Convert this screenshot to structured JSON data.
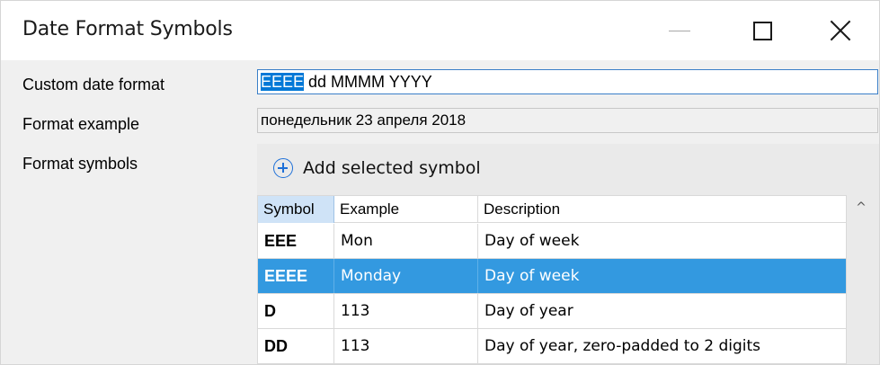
{
  "window": {
    "title": "Date Format Symbols",
    "minimize_icon": "minimize-icon",
    "maximize_icon": "maximize-icon",
    "close_icon": "close-icon"
  },
  "form": {
    "custom_format_label": "Custom date format",
    "custom_format_value_selected": "EEEE",
    "custom_format_value_rest": " dd MMMM YYYY",
    "example_label": "Format example",
    "example_value": "понедельник 23 апреля 2018",
    "symbols_label": "Format symbols"
  },
  "symbols": {
    "add_button_label": "Add selected symbol",
    "add_icon": "plus-circle-icon",
    "columns": [
      "Symbol",
      "Example",
      "Description"
    ],
    "rows": [
      {
        "symbol": "EEE",
        "example": "Mon",
        "description": "Day of week"
      },
      {
        "symbol": "EEEE",
        "example": "Monday",
        "description": "Day of week"
      },
      {
        "symbol": "D",
        "example": "113",
        "description": "Day of year"
      },
      {
        "symbol": "DD",
        "example": "113",
        "description": "Day of year, zero-padded to 2 digits"
      }
    ],
    "selected_row_index": 1,
    "scroll_up_glyph": "^"
  },
  "colors": {
    "selection": "#0078d7",
    "selected_row": "#3399e0",
    "header_sorted": "#cfe3f7",
    "accent_icon": "#1e70d8"
  }
}
